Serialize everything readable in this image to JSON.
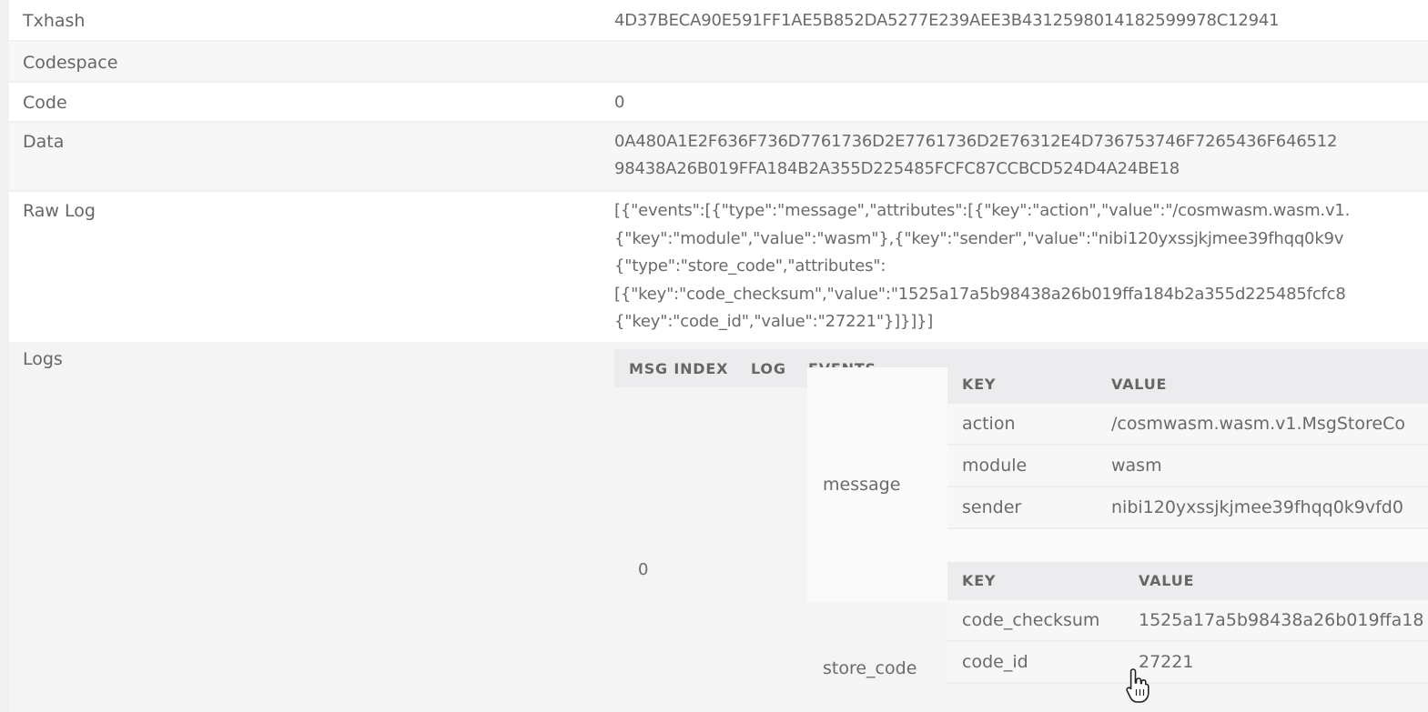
{
  "rows": {
    "txhash": {
      "label": "Txhash",
      "value": "4D37BECA90E591FF1AE5B852DA5277E239AEE3B4312598014182599978C12941"
    },
    "codespace": {
      "label": "Codespace",
      "value": ""
    },
    "code": {
      "label": "Code",
      "value": "0"
    },
    "data": {
      "label": "Data",
      "lines": [
        "0A480A1E2F636F736D7761736D2E7761736D2E76312E4D736753746F7265436F646512",
        "98438A26B019FFA184B2A355D225485FCFC87CCBCD524D4A24BE18"
      ]
    },
    "raw_log": {
      "label": "Raw Log",
      "lines": [
        "[{\"events\":[{\"type\":\"message\",\"attributes\":[{\"key\":\"action\",\"value\":\"/cosmwasm.wasm.v1.",
        "{\"key\":\"module\",\"value\":\"wasm\"},{\"key\":\"sender\",\"value\":\"nibi120yxssjkjmee39fhqq0k9v",
        "{\"type\":\"store_code\",\"attributes\":",
        "[{\"key\":\"code_checksum\",\"value\":\"1525a17a5b98438a26b019ffa184b2a355d225485fcfc8",
        "{\"key\":\"code_id\",\"value\":\"27221\"}]}]}]"
      ]
    }
  },
  "logs": {
    "label": "Logs",
    "headers": {
      "msg_index": "MSG INDEX",
      "log": "LOG",
      "events": "EVENTS"
    },
    "msg_index": "0",
    "events": [
      {
        "type": "message",
        "headers": {
          "key": "KEY",
          "value": "VALUE"
        },
        "attributes": [
          {
            "key": "action",
            "value": "/cosmwasm.wasm.v1.MsgStoreCo"
          },
          {
            "key": "module",
            "value": "wasm"
          },
          {
            "key": "sender",
            "value": "nibi120yxssjkjmee39fhqq0k9vfd0"
          }
        ]
      },
      {
        "type": "store_code",
        "headers": {
          "key": "KEY",
          "value": "VALUE"
        },
        "attributes": [
          {
            "key": "code_checksum",
            "value": "1525a17a5b98438a26b019ffa18"
          },
          {
            "key": "code_id",
            "value": "27221"
          }
        ]
      }
    ]
  },
  "cursor": {
    "icon": "hand-pointer-icon"
  }
}
